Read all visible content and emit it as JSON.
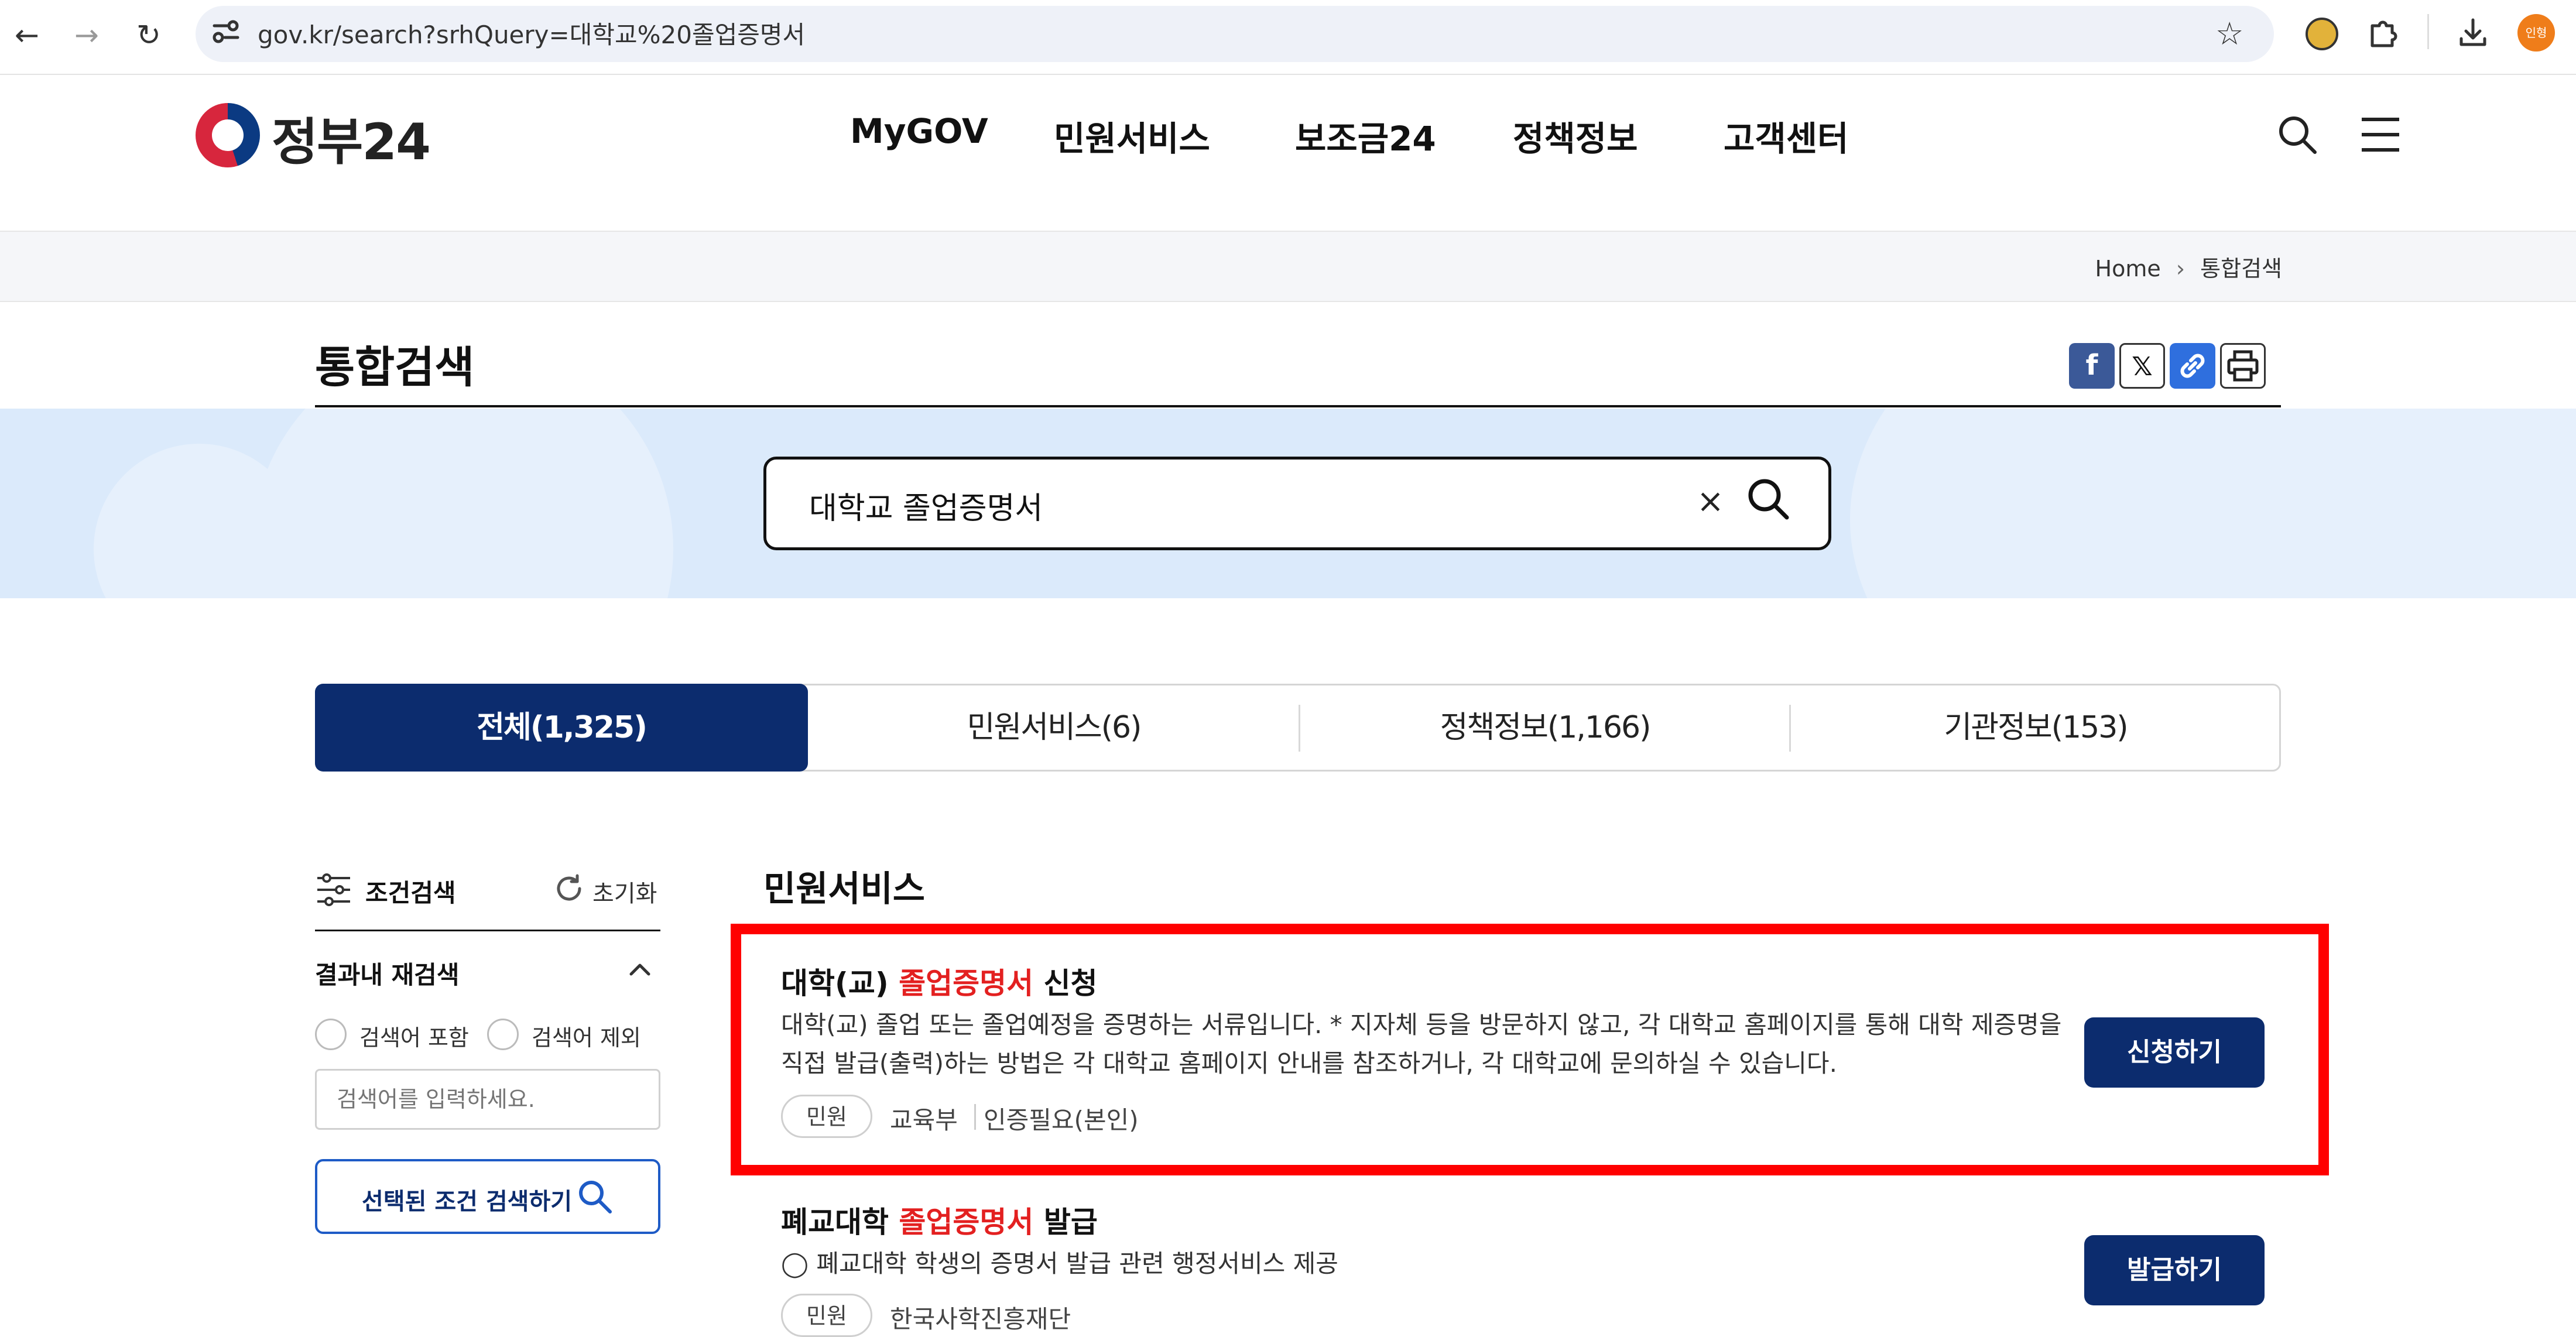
{
  "browser": {
    "url": "gov.kr/search?srhQuery=대학교%20졸업증명서",
    "profile_label": "인형"
  },
  "site": {
    "logo_text": "정부24",
    "nav": [
      "MyGOV",
      "민원서비스",
      "보조금24",
      "정책정보",
      "고객센터"
    ]
  },
  "breadcrumb": {
    "home": "Home",
    "current": "통합검색"
  },
  "page": {
    "title": "통합검색"
  },
  "share": {
    "facebook": "f",
    "x": "𝕏"
  },
  "search": {
    "value": "대학교 졸업증명서",
    "clear": "×"
  },
  "tabs": [
    {
      "label": "전체(1,325)",
      "active": true
    },
    {
      "label": "민원서비스(6)",
      "active": false
    },
    {
      "label": "정책정보(1,166)",
      "active": false
    },
    {
      "label": "기관정보(153)",
      "active": false
    }
  ],
  "sidebar": {
    "filter_label": "조건검색",
    "reset_label": "초기화",
    "research_label": "결과내 재검색",
    "include_label": "검색어 포함",
    "exclude_label": "검색어 제외",
    "input_placeholder": "검색어를 입력하세요.",
    "submit_label": "선택된 조건 검색하기"
  },
  "results": {
    "section_title": "민원서비스",
    "items": [
      {
        "title_pre": "대학(교) ",
        "title_hl": "졸업증명서",
        "title_post": " 신청",
        "desc_line1": "대학(교) 졸업 또는 졸업예정을 증명하는 서류입니다. * 지자체 등을 방문하지 않고, 각 대학교 홈페이지를 통해 대학 제증명을",
        "desc_line2": "직접 발급(출력)하는 방법은 각 대학교 홈페이지 안내를 참조하거나, 각 대학교에 문의하실 수 있습니다.",
        "tag": "민원",
        "org": "교육부",
        "auth": "인증필요(본인)",
        "button": "신청하기"
      },
      {
        "title_pre": "폐교대학 ",
        "title_hl": "졸업증명서",
        "title_post": " 발급",
        "desc_line1": "◯ 폐교대학 학생의 증명서 발급 관련 행정서비스 제공",
        "tag": "민원",
        "org": "한국사학진흥재단",
        "button": "발급하기"
      }
    ]
  },
  "colors": {
    "brand_navy": "#0c2c6e",
    "highlight_red": "#e32020",
    "annotation_red": "#ff0000",
    "hero_blue": "#dbeafb"
  }
}
